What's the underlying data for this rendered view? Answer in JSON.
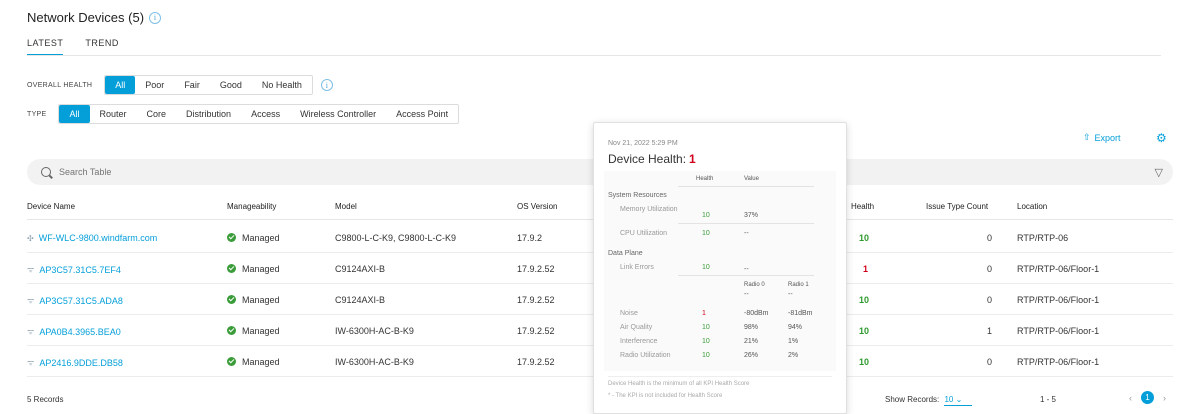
{
  "page": {
    "title": "Network Devices (5)",
    "info_icon": "info-icon",
    "view_tabs": [
      "LATEST",
      "TREND"
    ],
    "active_view_tab": "LATEST"
  },
  "overall_health": {
    "label": "OVERALL HEALTH",
    "options": [
      "All",
      "Poor",
      "Fair",
      "Good",
      "No Health"
    ],
    "selected": "All"
  },
  "type_filter": {
    "label": "TYPE",
    "options": [
      "All",
      "Router",
      "Core",
      "Distribution",
      "Access",
      "Wireless Controller",
      "Access Point"
    ],
    "selected": "All"
  },
  "toolbar": {
    "export_label": "Export",
    "export_icon": "export-icon",
    "settings_icon": "gear-icon"
  },
  "search": {
    "placeholder": "Search Table",
    "filter_icon": "filter-icon"
  },
  "table": {
    "columns": {
      "device_name": "Device Name",
      "manageability": "Manageability",
      "model": "Model",
      "os_version": "OS Version",
      "health": "Health",
      "issue_type_count": "Issue Type Count",
      "location": "Location"
    },
    "rows": [
      {
        "device_name": "WF-WLC-9800.windfarm.com",
        "manageability": "Managed",
        "model": "C9800-L-C-K9, C9800-L-C-K9",
        "os_version": "17.9.2",
        "health": "10",
        "issue_type_count": "0",
        "location": "RTP/RTP-06"
      },
      {
        "device_name": "AP3C57.31C5.7EF4",
        "manageability": "Managed",
        "model": "C9124AXI-B",
        "os_version": "17.9.2.52",
        "health": "1",
        "issue_type_count": "0",
        "location": "RTP/RTP-06/Floor-1"
      },
      {
        "device_name": "AP3C57.31C5.ADA8",
        "manageability": "Managed",
        "model": "C9124AXI-B",
        "os_version": "17.9.2.52",
        "health": "10",
        "issue_type_count": "0",
        "location": "RTP/RTP-06/Floor-1"
      },
      {
        "device_name": "APA0B4.3965.BEA0",
        "manageability": "Managed",
        "model": "IW-6300H-AC-B-K9",
        "os_version": "17.9.2.52",
        "health": "10",
        "issue_type_count": "1",
        "location": "RTP/RTP-06/Floor-1"
      },
      {
        "device_name": "AP2416.9DDE.DB58",
        "manageability": "Managed",
        "model": "IW-6300H-AC-B-K9",
        "os_version": "17.9.2.52",
        "health": "10",
        "issue_type_count": "0",
        "location": "RTP/RTP-06/Floor-1"
      }
    ]
  },
  "footer": {
    "records": "5 Records",
    "show_records_label": "Show Records:",
    "show_records_value": "10",
    "range": "1 - 5",
    "current_page": "1"
  },
  "tooltip": {
    "date": "Nov 21, 2022 5:29 PM",
    "title": "Device Health:",
    "score": "1",
    "col_health": "Health",
    "col_value": "Value",
    "system_resources": "System Resources",
    "memory_label": "Memory Utilization",
    "memory_health": "10",
    "memory_value": "37%",
    "cpu_label": "CPU Utilization",
    "cpu_health": "10",
    "cpu_value": "--",
    "data_plane": "Data Plane",
    "link_errors_label": "Link Errors",
    "link_errors_health": "10",
    "link_errors_value": "--",
    "radio0": "Radio 0",
    "radio1": "Radio 1",
    "radio0_dash": "--",
    "radio1_dash": "--",
    "noise_label": "Noise",
    "noise_health": "1",
    "noise_r0": "-80dBm",
    "noise_r1": "-81dBm",
    "air_label": "Air Quality",
    "air_health": "10",
    "air_r0": "98%",
    "air_r1": "94%",
    "interf_label": "Interference",
    "interf_health": "10",
    "interf_r0": "21%",
    "interf_r1": "1%",
    "radio_util_label": "Radio Utilization",
    "radio_util_health": "10",
    "radio_util_r0": "26%",
    "radio_util_r1": "2%",
    "note1": "Device Health is the minimum of all KPI Health Score",
    "note2": "* - The KPI is not included for Health Score"
  },
  "colors": {
    "accent": "#049fd9",
    "good": "#2e9a2e",
    "poor": "#d0021b"
  }
}
